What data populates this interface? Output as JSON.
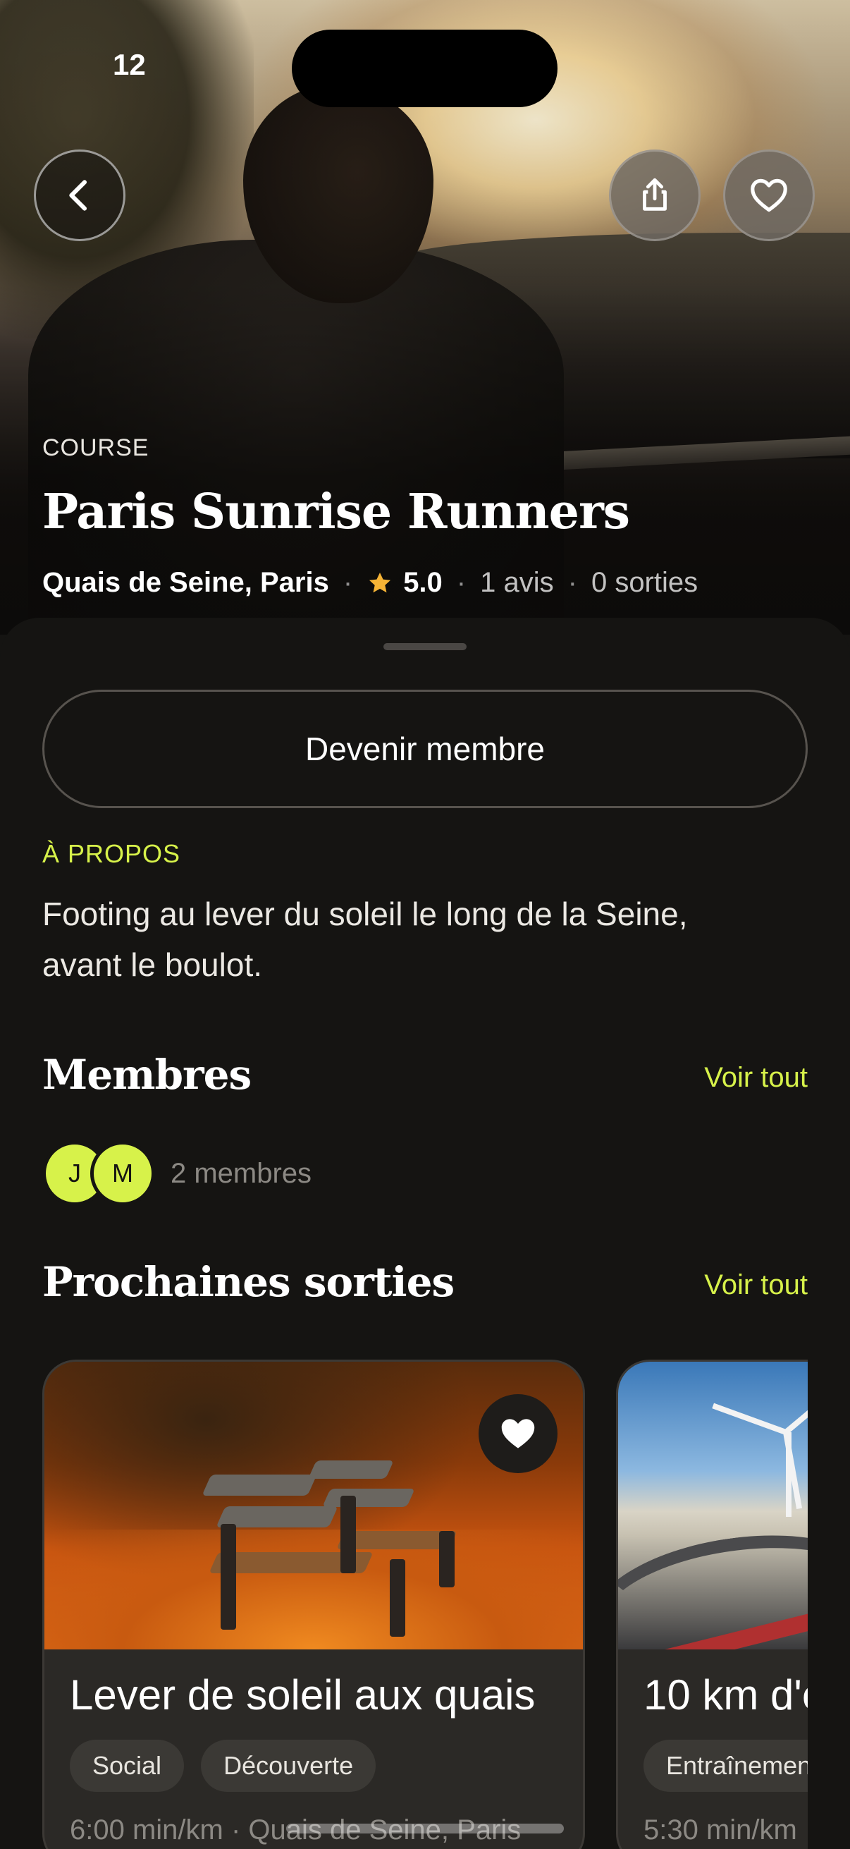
{
  "status_bar": {
    "time": "12"
  },
  "hero": {
    "category": "COURSE",
    "title": "Paris Sunrise Runners",
    "location": "Quais de Seine, Paris",
    "rating": "5.0",
    "reviews": "1 avis",
    "outings": "0 sorties",
    "separator": "·",
    "icons": {
      "back": "chevron-left-icon",
      "share": "share-icon",
      "favorite": "heart-icon",
      "rating": "star-icon"
    }
  },
  "actions": {
    "join_label": "Devenir membre"
  },
  "about": {
    "label": "À PROPOS",
    "text": "Footing au lever du soleil le long de la Seine, avant le boulot."
  },
  "members": {
    "title": "Membres",
    "see_all": "Voir tout",
    "avatars": [
      "J",
      "M"
    ],
    "count": "2 membres"
  },
  "outings": {
    "title": "Prochaines sorties",
    "see_all": "Voir tout",
    "cards": [
      {
        "title": "Lever de soleil aux quais",
        "chips": [
          "Social",
          "Découverte"
        ],
        "meta": "6:00 min/km · Quais de Seine, Paris"
      },
      {
        "title": "10 km d'e",
        "chips": [
          "Entraînemen"
        ],
        "meta": "5:30 min/km"
      }
    ]
  },
  "colors": {
    "accent": "#d7f24a",
    "background": "#151412",
    "card": "#2b2926",
    "star": "#f5b335"
  }
}
